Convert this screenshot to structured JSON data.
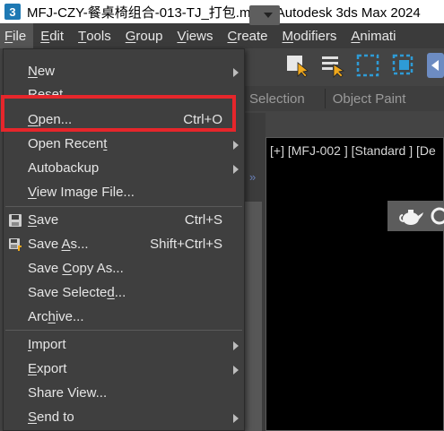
{
  "window": {
    "app_icon": "3",
    "title": "MFJ-CZY-餐桌椅组合-013-TJ_打包.max - Autodesk 3ds Max 2024"
  },
  "menubar": {
    "items": [
      {
        "label": "File",
        "mnemonic": "F",
        "rest": "ile"
      },
      {
        "label": "Edit",
        "mnemonic": "E",
        "rest": "dit"
      },
      {
        "label": "Tools",
        "mnemonic": "T",
        "rest": "ools"
      },
      {
        "label": "Group",
        "mnemonic": "G",
        "rest": "roup"
      },
      {
        "label": "Views",
        "mnemonic": "V",
        "rest": "iews"
      },
      {
        "label": "Create",
        "mnemonic": "C",
        "rest": "reate"
      },
      {
        "label": "Modifiers",
        "mnemonic": "M",
        "rest": "odifiers"
      },
      {
        "label": "Animati",
        "mnemonic": "A",
        "rest": "nimati"
      }
    ]
  },
  "tabs": {
    "selection": "Selection",
    "object_paint": "Object Paint"
  },
  "viewport": {
    "label": "[+] [MFJ-002 ] [Standard ] [De"
  },
  "sidebar": {
    "arrows": "»"
  },
  "file_menu": {
    "new": {
      "pre": "",
      "mn": "N",
      "post": "ew"
    },
    "reset": {
      "pre": "",
      "mn": "R",
      "post": "eset"
    },
    "open": {
      "pre": "",
      "mn": "O",
      "post": "pen...",
      "shortcut": "Ctrl+O"
    },
    "open_recent": {
      "pre": "Open Recen",
      "mn": "t",
      "post": ""
    },
    "autobackup": {
      "pre": "Autobackup",
      "mn": "",
      "post": ""
    },
    "view_image": {
      "pre": "",
      "mn": "V",
      "post": "iew Image File..."
    },
    "save": {
      "pre": "",
      "mn": "S",
      "post": "ave",
      "shortcut": "Ctrl+S"
    },
    "save_as": {
      "pre": "Save ",
      "mn": "A",
      "post": "s...",
      "shortcut": "Shift+Ctrl+S"
    },
    "save_copy": {
      "pre": "Save ",
      "mn": "C",
      "post": "opy As..."
    },
    "save_selected": {
      "pre": "Save Selecte",
      "mn": "d",
      "post": "..."
    },
    "archive": {
      "pre": "Arc",
      "mn": "h",
      "post": "ive..."
    },
    "import": {
      "pre": "",
      "mn": "I",
      "post": "mport"
    },
    "export": {
      "pre": "",
      "mn": "E",
      "post": "xport"
    },
    "share_view": {
      "pre": "Share View...",
      "mn": "",
      "post": ""
    },
    "send_to": {
      "pre": "",
      "mn": "S",
      "post": "end to"
    }
  },
  "colors": {
    "highlight_border": "#e6262b",
    "menu_bg": "#3f3f3f",
    "toolbar_accent": "#f0a81c",
    "select_blue": "#2e9bd6"
  }
}
